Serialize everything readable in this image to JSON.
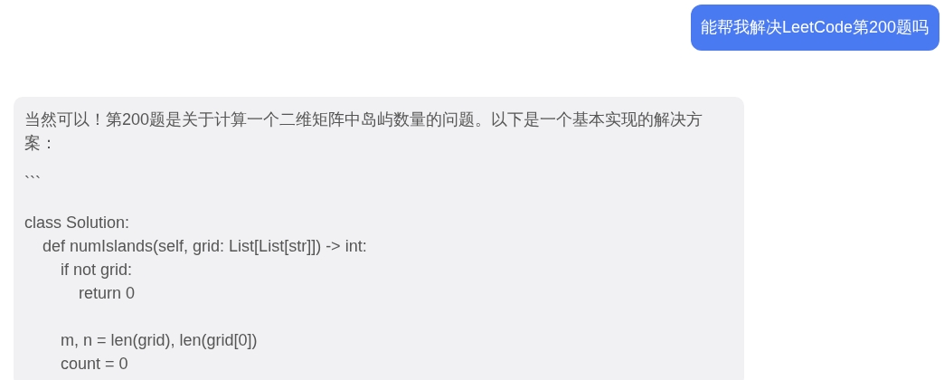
{
  "messages": [
    {
      "kind": "user",
      "text": "能帮我解决LeetCode第200题吗"
    },
    {
      "kind": "assistant",
      "paragraphs": [
        "当然可以！第200题是关于计算一个二维矩阵中岛屿数量的问题。以下是一个基本实现的解决方案：",
        "```"
      ],
      "code": "class Solution:\n    def numIslands(self, grid: List[List[str]]) -> int:\n        if not grid:\n            return 0\n\n        m, n = len(grid), len(grid[0])\n        count = 0"
    }
  ]
}
